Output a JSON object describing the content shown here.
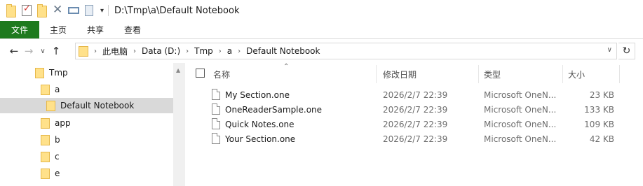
{
  "window": {
    "title": "D:\\Tmp\\a\\Default Notebook",
    "quick_access_icons": [
      "folder-icon",
      "properties-check-icon",
      "new-folder-icon",
      "delete-icon",
      "rename-icon",
      "clipboard-icon"
    ],
    "customize_arrow": "▾"
  },
  "ribbon": {
    "tabs": [
      {
        "label": "文件"
      },
      {
        "label": "主页"
      },
      {
        "label": "共享"
      },
      {
        "label": "查看"
      }
    ],
    "file_tab_color": "#1e7a1e"
  },
  "address": {
    "back": "←",
    "forward": "→",
    "recent": "∨",
    "up": "↑",
    "crumbs": [
      "此电脑",
      "Data (D:)",
      "Tmp",
      "a",
      "Default Notebook"
    ],
    "separator": "›",
    "dropdown": "∨",
    "refresh": "↻"
  },
  "nav_pane": {
    "items": [
      {
        "label": "Tmp",
        "selected": false
      },
      {
        "label": "a",
        "selected": false
      },
      {
        "label": "Default Notebook",
        "selected": true
      },
      {
        "label": "app",
        "selected": false
      },
      {
        "label": "b",
        "selected": false
      },
      {
        "label": "c",
        "selected": false
      },
      {
        "label": "e",
        "selected": false
      }
    ],
    "scroll_up": "▲"
  },
  "file_list": {
    "sort_indicator": "⌃",
    "columns": {
      "name": "名称",
      "date": "修改日期",
      "type": "类型",
      "size": "大小"
    },
    "rows": [
      {
        "name": "My Section.one",
        "date": "2026/2/7 22:39",
        "type": "Microsoft OneN...",
        "size": "23 KB"
      },
      {
        "name": "OneReaderSample.one",
        "date": "2026/2/7 22:39",
        "type": "Microsoft OneN...",
        "size": "133 KB"
      },
      {
        "name": "Quick Notes.one",
        "date": "2026/2/7 22:39",
        "type": "Microsoft OneN...",
        "size": "109 KB"
      },
      {
        "name": "Your Section.one",
        "date": "2026/2/7 22:39",
        "type": "Microsoft OneN...",
        "size": "42 KB"
      }
    ]
  }
}
